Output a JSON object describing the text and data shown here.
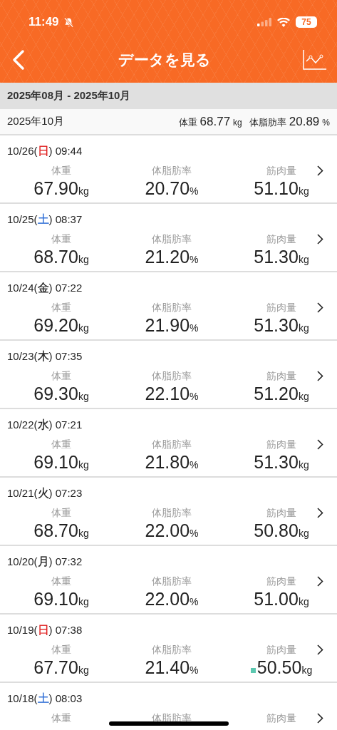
{
  "status_bar": {
    "time": "11:49",
    "battery": "75"
  },
  "nav": {
    "title": "データを見る"
  },
  "period": "2025年08月 - 2025年10月",
  "month": {
    "label": "2025年10月",
    "weight_label": "体重",
    "weight": "68.77",
    "weight_unit": "kg",
    "fat_label": "体脂肪率",
    "fat": "20.89",
    "fat_unit": "%"
  },
  "rows": [
    {
      "date": "10/26(",
      "day": {
        "text": "日",
        "color": "#e02020"
      },
      "time": ") 09:44",
      "metrics": [
        {
          "label": "体重",
          "value": "67.90",
          "unit": "kg",
          "marker": false
        },
        {
          "label": "体脂肪率",
          "value": "20.70",
          "unit": "%",
          "marker": false
        },
        {
          "label": "筋肉量",
          "value": "51.10",
          "unit": "kg",
          "marker": false
        }
      ]
    },
    {
      "date": "10/25(",
      "day": {
        "text": "土",
        "color": "#2f6fd6"
      },
      "time": ") 08:37",
      "metrics": [
        {
          "label": "体重",
          "value": "68.70",
          "unit": "kg",
          "marker": false
        },
        {
          "label": "体脂肪率",
          "value": "21.20",
          "unit": "%",
          "marker": false
        },
        {
          "label": "筋肉量",
          "value": "51.30",
          "unit": "kg",
          "marker": false
        }
      ]
    },
    {
      "date": "10/24(",
      "day": {
        "text": "金",
        "color": "#222222"
      },
      "time": ") 07:22",
      "metrics": [
        {
          "label": "体重",
          "value": "69.20",
          "unit": "kg",
          "marker": false
        },
        {
          "label": "体脂肪率",
          "value": "21.90",
          "unit": "%",
          "marker": false
        },
        {
          "label": "筋肉量",
          "value": "51.30",
          "unit": "kg",
          "marker": false
        }
      ]
    },
    {
      "date": "10/23(",
      "day": {
        "text": "木",
        "color": "#222222"
      },
      "time": ") 07:35",
      "metrics": [
        {
          "label": "体重",
          "value": "69.30",
          "unit": "kg",
          "marker": false
        },
        {
          "label": "体脂肪率",
          "value": "22.10",
          "unit": "%",
          "marker": false
        },
        {
          "label": "筋肉量",
          "value": "51.20",
          "unit": "kg",
          "marker": false
        }
      ]
    },
    {
      "date": "10/22(",
      "day": {
        "text": "水",
        "color": "#222222"
      },
      "time": ") 07:21",
      "metrics": [
        {
          "label": "体重",
          "value": "69.10",
          "unit": "kg",
          "marker": false
        },
        {
          "label": "体脂肪率",
          "value": "21.80",
          "unit": "%",
          "marker": false
        },
        {
          "label": "筋肉量",
          "value": "51.30",
          "unit": "kg",
          "marker": false
        }
      ]
    },
    {
      "date": "10/21(",
      "day": {
        "text": "火",
        "color": "#222222"
      },
      "time": ") 07:23",
      "metrics": [
        {
          "label": "体重",
          "value": "68.70",
          "unit": "kg",
          "marker": false
        },
        {
          "label": "体脂肪率",
          "value": "22.00",
          "unit": "%",
          "marker": false
        },
        {
          "label": "筋肉量",
          "value": "50.80",
          "unit": "kg",
          "marker": false
        }
      ]
    },
    {
      "date": "10/20(",
      "day": {
        "text": "月",
        "color": "#222222"
      },
      "time": ") 07:32",
      "metrics": [
        {
          "label": "体重",
          "value": "69.10",
          "unit": "kg",
          "marker": false
        },
        {
          "label": "体脂肪率",
          "value": "22.00",
          "unit": "%",
          "marker": false
        },
        {
          "label": "筋肉量",
          "value": "51.00",
          "unit": "kg",
          "marker": false
        }
      ]
    },
    {
      "date": "10/19(",
      "day": {
        "text": "日",
        "color": "#e02020"
      },
      "time": ") 07:38",
      "metrics": [
        {
          "label": "体重",
          "value": "67.70",
          "unit": "kg",
          "marker": false
        },
        {
          "label": "体脂肪率",
          "value": "21.40",
          "unit": "%",
          "marker": false
        },
        {
          "label": "筋肉量",
          "value": "50.50",
          "unit": "kg",
          "marker": true
        }
      ]
    },
    {
      "date": "10/18(",
      "day": {
        "text": "土",
        "color": "#2f6fd6"
      },
      "time": ") 08:03",
      "metrics": [
        {
          "label": "体重",
          "marker": false
        },
        {
          "label": "体脂肪率",
          "marker": false
        },
        {
          "label": "筋肉量",
          "marker": false
        }
      ]
    }
  ]
}
